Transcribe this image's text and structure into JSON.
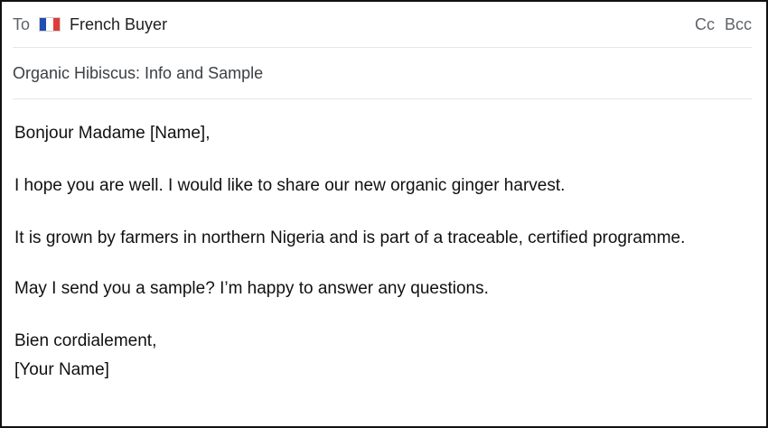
{
  "compose": {
    "to_label": "To",
    "recipient": {
      "flag_icon": "france-flag-icon",
      "flag_colors": [
        "#1f4fb4",
        "#ffffff",
        "#e03b3b"
      ],
      "name": "French Buyer"
    },
    "cc_label": "Cc",
    "bcc_label": "Bcc",
    "subject": "Organic Hibiscus: Info and Sample",
    "body": {
      "greeting": "Bonjour Madame [Name],",
      "paragraphs": [
        "I hope you are well. I would like to share our new organic ginger harvest.",
        "It is grown by farmers in northern Nigeria and is part of a traceable, certified programme.",
        "May I send you a sample? I’m happy to answer any questions."
      ],
      "closing": "Bien cordialement,",
      "signature": "[Your Name]"
    }
  }
}
